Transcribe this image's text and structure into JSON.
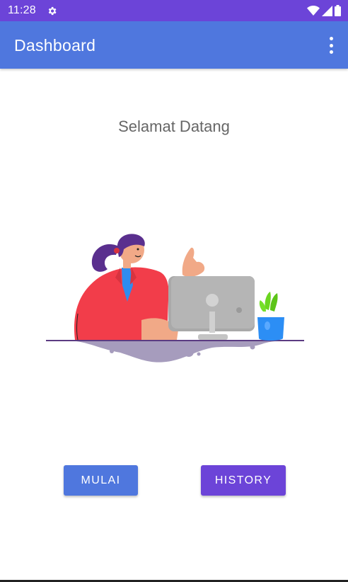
{
  "status_bar": {
    "time": "11:28",
    "icons": [
      "settings-icon",
      "wifi-icon",
      "signal-icon",
      "battery-icon"
    ]
  },
  "app_bar": {
    "title": "Dashboard",
    "menu_icon": "more-vert-icon"
  },
  "main": {
    "welcome_text": "Selamat Datang",
    "illustration": "woman-at-computer-illustration"
  },
  "buttons": {
    "start_label": "MULAI",
    "history_label": "HISTORY"
  },
  "colors": {
    "status_bar": "#6c44d8",
    "app_bar": "#4f77de",
    "primary_button": "#4f77de",
    "secondary_button": "#6c44d8"
  }
}
